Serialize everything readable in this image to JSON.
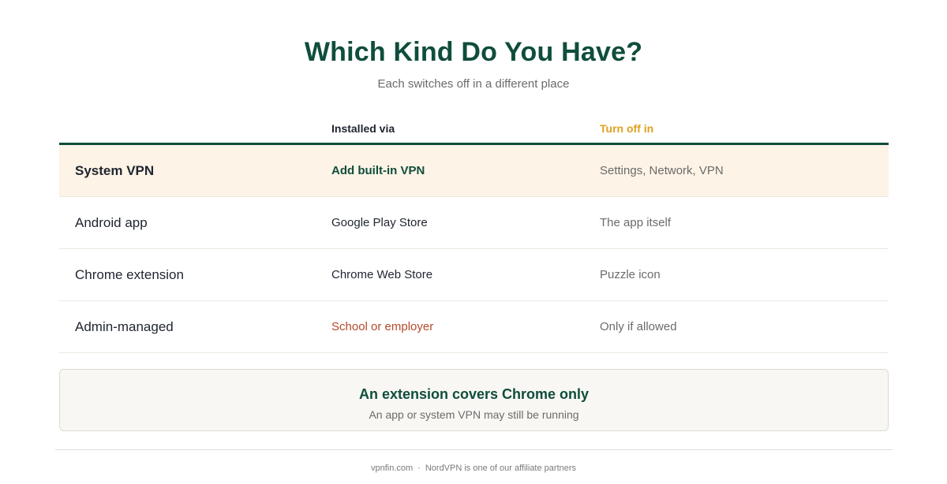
{
  "header": {
    "title": "Which Kind Do You Have?",
    "subtitle": "Each switches off in a different place"
  },
  "table": {
    "columns": [
      "",
      "Installed via",
      "Turn off in"
    ],
    "column_colors": {
      "installed_via": "#1f2430",
      "turn_off_in": "#e0a020"
    },
    "rows": [
      {
        "type": "System VPN",
        "installed_via": "Add built-in VPN",
        "turn_off_in": "Settings, Network, VPN",
        "highlighted": true
      },
      {
        "type": "Android app",
        "installed_via": "Google Play Store",
        "turn_off_in": "The app itself"
      },
      {
        "type": "Chrome extension",
        "installed_via": "Chrome Web Store",
        "turn_off_in": "Puzzle icon"
      },
      {
        "type": "Admin-managed",
        "installed_via": "School or employer",
        "turn_off_in": "Only if allowed",
        "installed_via_color": "#b44a2a"
      }
    ]
  },
  "note": {
    "title": "An extension covers Chrome only",
    "subtitle": "An app or system VPN may still be running"
  },
  "footer": {
    "site": "vpnfin.com",
    "separator": "·",
    "disclosure": "NordVPN is one of our affiliate partners"
  },
  "colors": {
    "brand_green": "#0f4d3c",
    "accent_gold": "#e0a020",
    "highlight_bg": "#fdf3e6",
    "warning_text": "#b44a2a"
  }
}
